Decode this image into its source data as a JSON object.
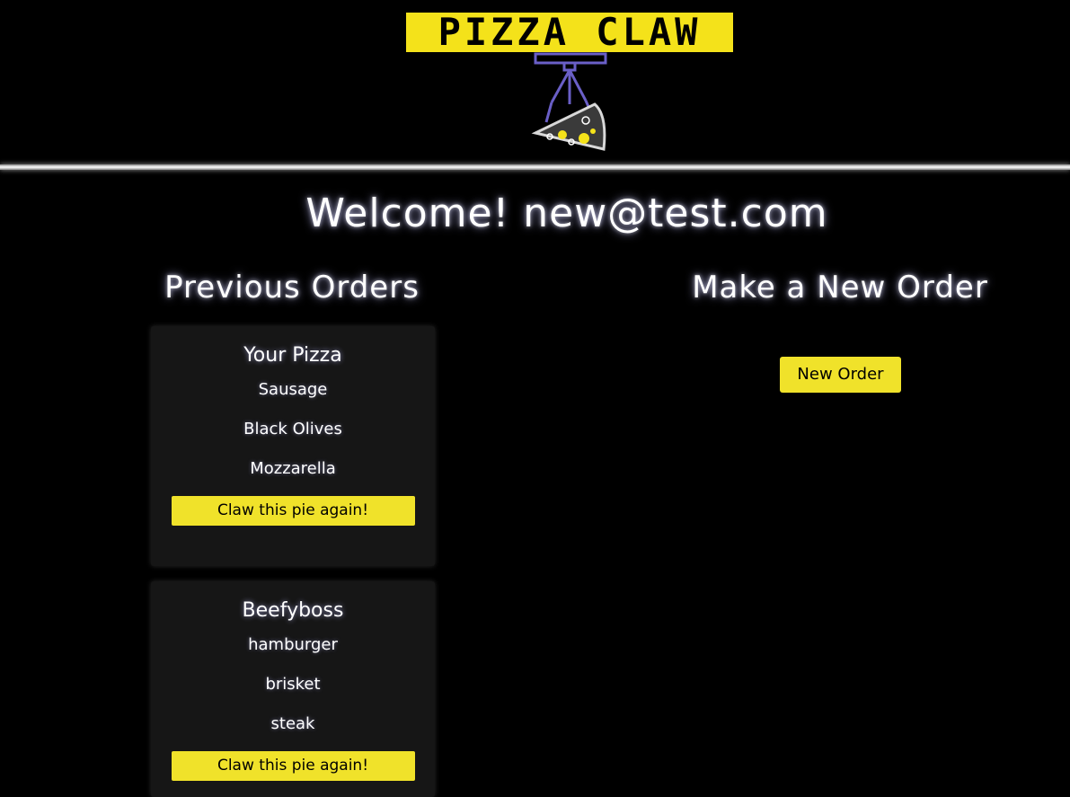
{
  "header": {
    "logo_text": "PIZZA CLAW",
    "logo_colors": {
      "box": "#f4e21a",
      "claw": "#6a5fc7",
      "pizza_yellow": "#f4e21a"
    }
  },
  "welcome": {
    "text": "Welcome! new@test.com"
  },
  "previous_orders": {
    "title": "Previous Orders",
    "orders": [
      {
        "name": "Your Pizza",
        "toppings": [
          "Sausage",
          "Black Olives",
          "Mozzarella"
        ],
        "button_label": "Claw this pie again!"
      },
      {
        "name": "Beefyboss",
        "toppings": [
          "hamburger",
          "brisket",
          "steak"
        ],
        "button_label": "Claw this pie again!"
      }
    ]
  },
  "new_order": {
    "title": "Make a New Order",
    "button_label": "New Order"
  },
  "colors": {
    "background": "#000000",
    "accent_yellow": "#f0e22a",
    "card": "#161616"
  }
}
